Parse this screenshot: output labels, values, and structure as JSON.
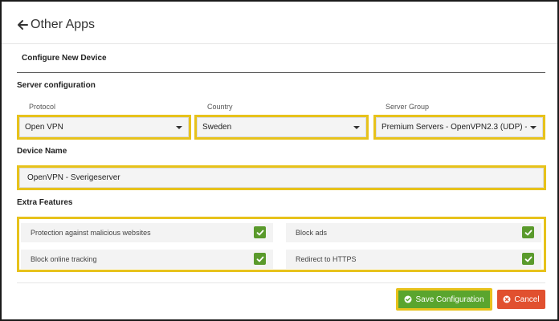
{
  "header": {
    "back_icon": "arrow-left-icon",
    "title": "Other Apps"
  },
  "card": {
    "title": "Configure New Device"
  },
  "server_configuration": {
    "title": "Server configuration",
    "protocol": {
      "label": "Protocol",
      "value": "Open VPN"
    },
    "country": {
      "label": "Country",
      "value": "Sweden"
    },
    "server_group": {
      "label": "Server Group",
      "value": "Premium Servers - OpenVPN2.3 (UDP) -"
    }
  },
  "device_name": {
    "title": "Device Name",
    "value": "OpenVPN - Sverigeserver"
  },
  "extra_features": {
    "title": "Extra Features",
    "items": [
      {
        "label": "Protection against malicious websites",
        "checked": true
      },
      {
        "label": "Block ads",
        "checked": true
      },
      {
        "label": "Block online tracking",
        "checked": true
      },
      {
        "label": "Redirect to HTTPS",
        "checked": true
      }
    ]
  },
  "actions": {
    "save_label": "Save Configuration",
    "save_icon": "check-circle-icon",
    "cancel_label": "Cancel",
    "cancel_icon": "close-circle-icon"
  },
  "colors": {
    "highlight": "#e7c21b",
    "check_green": "#5a9a2c",
    "save_green": "#5aa52e",
    "cancel_red": "#e1502f"
  }
}
